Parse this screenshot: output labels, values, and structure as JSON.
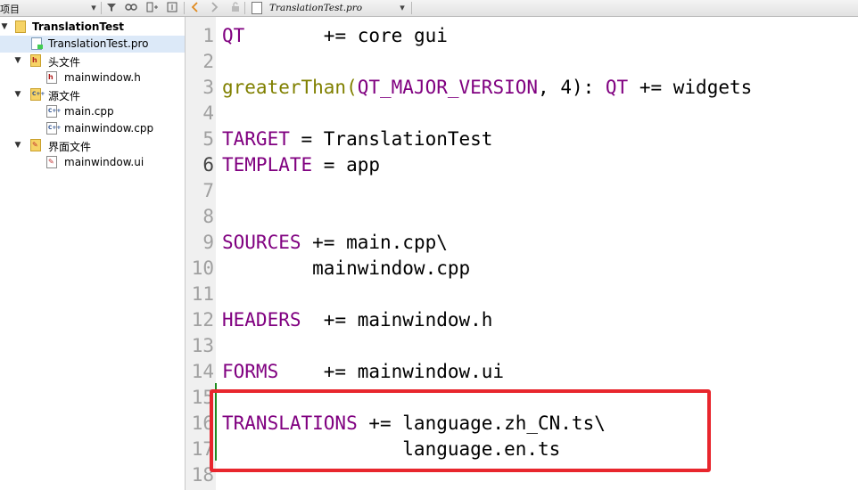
{
  "toolbar": {
    "panel_title": "项目",
    "file_tab_name": "TranslationTest.pro"
  },
  "tree": {
    "root": "TranslationTest",
    "items": [
      {
        "label": "TranslationTest.pro"
      },
      {
        "label": "头文件"
      },
      {
        "label": "mainwindow.h"
      },
      {
        "label": "源文件"
      },
      {
        "label": "main.cpp"
      },
      {
        "label": "mainwindow.cpp"
      },
      {
        "label": "界面文件"
      },
      {
        "label": "mainwindow.ui"
      }
    ]
  },
  "editor": {
    "current_line": 6,
    "line_numbers": [
      "1",
      "2",
      "3",
      "4",
      "5",
      "6",
      "7",
      "8",
      "9",
      "10",
      "11",
      "12",
      "13",
      "14",
      "15",
      "16",
      "17",
      "18"
    ],
    "lines": {
      "l1": {
        "kw": "QT",
        "rest": "       += core gui"
      },
      "l3": {
        "fn": "greaterThan",
        "open": "(",
        "kw1": "QT_MAJOR_VERSION",
        "rest": ", 4): ",
        "kw2": "QT",
        "tail": " += widgets"
      },
      "l5": {
        "kw": "TARGET",
        "rest": " = TranslationTest"
      },
      "l6": {
        "kw": "TEMPLATE",
        "rest": " = app"
      },
      "l9": {
        "kw": "SOURCES",
        "rest": " += main.cpp\\"
      },
      "l10": {
        "rest": "        mainwindow.cpp"
      },
      "l12": {
        "kw": "HEADERS",
        "rest": "  += mainwindow.h"
      },
      "l14": {
        "kw": "FORMS",
        "rest": "    += mainwindow.ui"
      },
      "l16": {
        "kw": "TRANSLATIONS",
        "rest": " += language.zh_CN.ts\\"
      },
      "l17": {
        "rest": "                language.en.ts"
      }
    }
  },
  "colors": {
    "keyword": "#800080",
    "function": "#808000",
    "highlight_box": "#e8262d",
    "selection": "#dce9f8",
    "change_marker": "#1e8c1e"
  }
}
